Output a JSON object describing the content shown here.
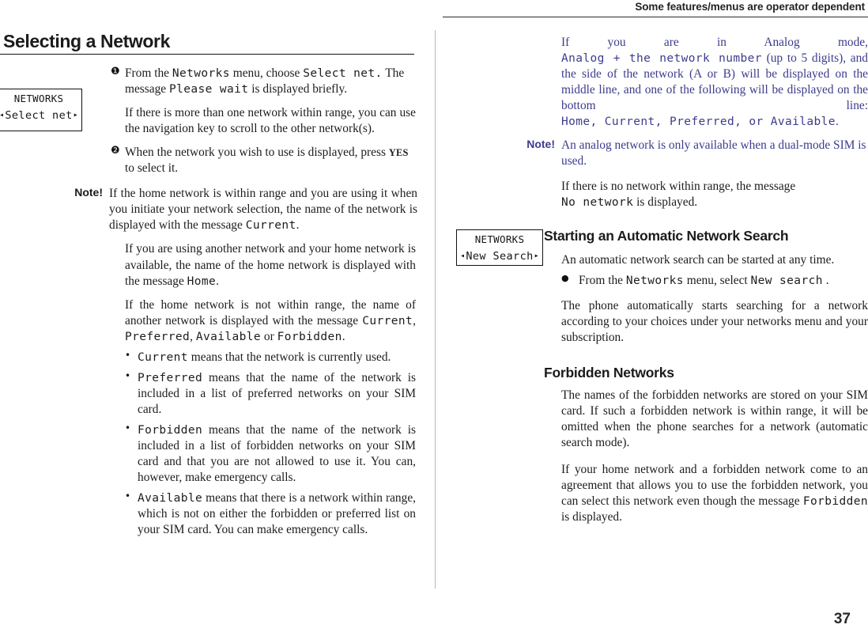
{
  "header": {
    "running_title": "Some features/menus are operator dependent"
  },
  "page_number": "37",
  "left_column": {
    "heading": "Selecting a Network",
    "lcd_box": {
      "title": "NETWORKS",
      "left_arrow": "◂",
      "value": "Select net",
      "right_arrow": "▸"
    },
    "step1": {
      "marker": "❶",
      "t1": "From the ",
      "lcd1": "Networks",
      "t2": " menu, choose ",
      "lcd2": "Select net.",
      "t3": "  The message ",
      "lcd3": "Please wait",
      "t4": " is displayed briefly."
    },
    "step1_note": "If there is more than one network within range, you can use the navigation key to scroll to the other network(s).",
    "step2": {
      "marker": "❷",
      "t1": "When the network you wish to use is displayed, press ",
      "yes": "YES",
      "t2": " to select it."
    },
    "note_label": "Note!",
    "note_body": {
      "t1": "If the home network is within range and you are using it when you initiate your network selection, the name of the network is displayed with the message ",
      "lcd1": "Current",
      "t2": "."
    },
    "para_home": {
      "t1": "If you are using another network and your home network is available, the name of the home network is displayed with the message ",
      "lcd1": "Home",
      "t2": "."
    },
    "para_notrange": {
      "t1": "If the home network is not within range, the name of another network is displayed with the message ",
      "lcd1": "Current",
      "t2": ", ",
      "lcd2": "Preferred",
      "t3": ", ",
      "lcd3": "Available",
      "t4": " or ",
      "lcd4": "Forbidden",
      "t5": "."
    },
    "bullets": [
      {
        "lcd": "Current",
        "text": " means that the network is currently used."
      },
      {
        "lcd": "Preferred",
        "text": " means that the name of the network is included in a list of preferred networks on your SIM card."
      },
      {
        "lcd": "Forbidden",
        "text": " means that the name of the network is included in a list of forbidden networks on your SIM card and that you are not allowed to use it. You can, however, make emergency calls."
      },
      {
        "lcd": "Available",
        "text": " means that there is a network within range, which is not on either the forbidden or preferred list on your SIM card. You can make emergency calls."
      }
    ],
    "bullet_glyph": "•"
  },
  "right_column": {
    "analog_para": {
      "t1": "If you are in Analog mode, ",
      "lcd1": "Analog + the network number",
      "t2": "  (up to 5 digits), and the side of the network (A or B) will be displayed on the middle line,  and one of the following will be displayed on the bottom line: ",
      "lcd2": "Home, Current, Preferred, or Available",
      "t3": "."
    },
    "note_label": "Note!",
    "note_body": "An analog network is only available when a dual-mode SIM is used.",
    "no_network_para": {
      "t1": "If there is no network within range, the message ",
      "lcd1": "No network",
      "t2": " is displayed."
    },
    "auto_search": {
      "heading": "Starting an Automatic Network Search",
      "lcd_box": {
        "title": "NETWORKS",
        "left_arrow": "◂",
        "value": "New Search",
        "right_arrow": "▸"
      },
      "intro": "An automatic network search can be started at any time.",
      "bullet_glyph": "●",
      "bullet": {
        "t1": "From the ",
        "lcd1": "Networks",
        "t2": " menu, select ",
        "lcd2": "New search",
        "t3": " ."
      },
      "outro": "The phone  automatically starts searching for a network according to your choices under your networks menu and your subscription."
    },
    "forbidden": {
      "heading": "Forbidden Networks",
      "p1": "The names of the forbidden networks are stored on your SIM card. If such a forbidden network is within range, it will be omitted when the phone searches for a network (automatic search mode).",
      "p2": {
        "t1": "If your home network and a forbidden network come to an agreement that allows you to use the forbidden network, you can select this network even though the message ",
        "lcd1": "Forbidden",
        "t2": " is displayed."
      }
    }
  },
  "colors": {
    "blue_text": "#3c3c8e",
    "rule": "#111111",
    "divider": "#b9b9b9"
  }
}
